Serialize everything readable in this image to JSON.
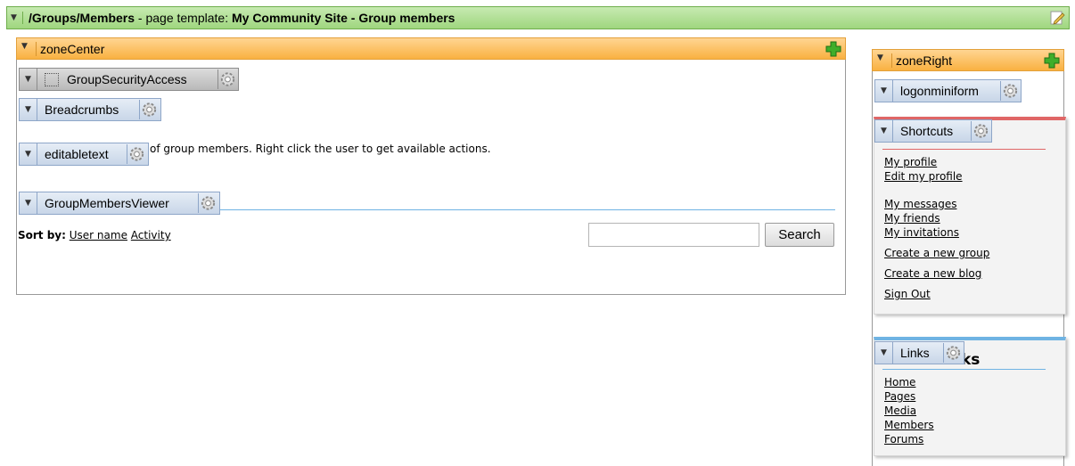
{
  "page_template": {
    "path": "/Groups/Members",
    "separator": " - page template: ",
    "template_name": "My Community Site - Group members"
  },
  "zone_center": {
    "label": "zoneCenter",
    "webparts": {
      "security": "GroupSecurityAccess",
      "breadcrumbs": "Breadcrumbs",
      "editabletext": "editabletext",
      "members_viewer": "GroupMembersViewer"
    },
    "description_text": "of group members. Right click the user to get available actions.",
    "sort_label": "Sort by:",
    "sort_options": [
      "User name",
      "Activity"
    ],
    "search": {
      "value": "",
      "button": "Search"
    }
  },
  "zone_right": {
    "label": "zoneRight",
    "webparts": {
      "logon": "logonminiform",
      "shortcuts": "Shortcuts",
      "links": "Links"
    },
    "shortcuts_links": [
      "My profile",
      "Edit my profile",
      "My messages",
      "My friends",
      "My invitations",
      "Create a new group",
      "Create a new blog",
      "Sign Out"
    ],
    "links_partial_heading": "ks",
    "links_items": [
      "Home",
      "Pages",
      "Media",
      "Members",
      "Forums"
    ]
  },
  "colors": {
    "page_bar": "#9fd67f",
    "zone_header": "#f9b141",
    "webpart_header": "#c8d6e8",
    "shortcuts_accent": "#e06666",
    "links_accent": "#6fb3e3"
  },
  "icons": [
    "edit-page-icon",
    "add-webpart-icon",
    "gear-icon",
    "collapse-arrow-icon"
  ]
}
